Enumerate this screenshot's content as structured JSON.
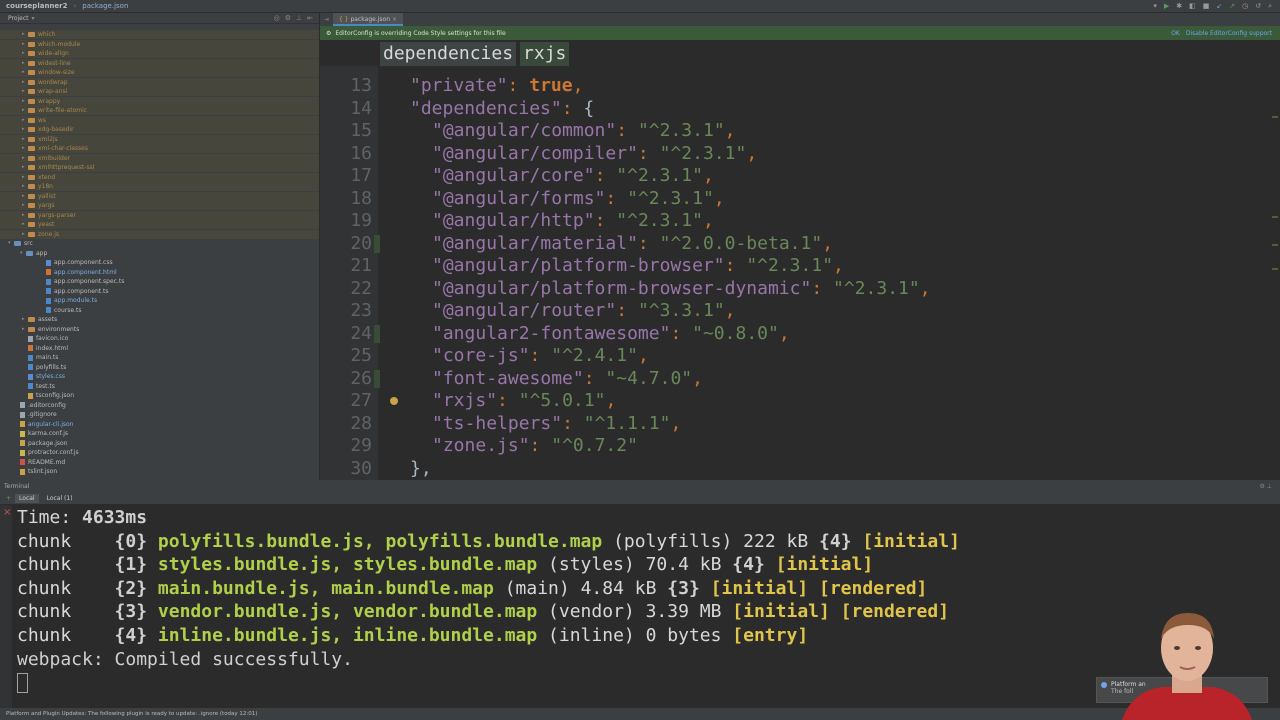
{
  "navbar": {
    "project": "courseplanner2",
    "file": "package.json"
  },
  "project_panel": {
    "title": "Project",
    "items": [
      {
        "label": "which",
        "kind": "folder",
        "style": "dim"
      },
      {
        "label": "which-module",
        "kind": "folder",
        "style": "dim"
      },
      {
        "label": "wide-align",
        "kind": "folder",
        "style": "dim"
      },
      {
        "label": "widest-line",
        "kind": "folder",
        "style": "dim"
      },
      {
        "label": "window-size",
        "kind": "folder",
        "style": "dim"
      },
      {
        "label": "wordwrap",
        "kind": "folder",
        "style": "dim"
      },
      {
        "label": "wrap-ansi",
        "kind": "folder",
        "style": "dim"
      },
      {
        "label": "wrappy",
        "kind": "folder",
        "style": "dim"
      },
      {
        "label": "write-file-atomic",
        "kind": "folder",
        "style": "dim"
      },
      {
        "label": "ws",
        "kind": "folder",
        "style": "dim"
      },
      {
        "label": "xdg-basedir",
        "kind": "folder",
        "style": "dim"
      },
      {
        "label": "xml2js",
        "kind": "folder",
        "style": "dim"
      },
      {
        "label": "xml-char-classes",
        "kind": "folder",
        "style": "dim"
      },
      {
        "label": "xmlbuilder",
        "kind": "folder",
        "style": "dim"
      },
      {
        "label": "xmlhttprequest-ssl",
        "kind": "folder",
        "style": "dim"
      },
      {
        "label": "xtend",
        "kind": "folder",
        "style": "dim"
      },
      {
        "label": "y18n",
        "kind": "folder",
        "style": "dim"
      },
      {
        "label": "yallist",
        "kind": "folder",
        "style": "dim"
      },
      {
        "label": "yargs",
        "kind": "folder",
        "style": "dim"
      },
      {
        "label": "yargs-parser",
        "kind": "folder",
        "style": "dim"
      },
      {
        "label": "yeast",
        "kind": "folder",
        "style": "dim"
      },
      {
        "label": "zone.js",
        "kind": "folder",
        "style": "dim"
      },
      {
        "label": "src",
        "kind": "folder-open",
        "style": "norm"
      },
      {
        "label": "app",
        "kind": "folder-open",
        "style": "norm"
      },
      {
        "label": "app.component.css",
        "kind": "file",
        "style": "norm"
      },
      {
        "label": "app.component.html",
        "kind": "file",
        "style": "blue"
      },
      {
        "label": "app.component.spec.ts",
        "kind": "file",
        "style": "norm"
      },
      {
        "label": "app.component.ts",
        "kind": "file",
        "style": "norm"
      },
      {
        "label": "app.module.ts",
        "kind": "file",
        "style": "blue"
      },
      {
        "label": "course.ts",
        "kind": "file",
        "style": "norm"
      },
      {
        "label": "assets",
        "kind": "folder",
        "style": "norm"
      },
      {
        "label": "environments",
        "kind": "folder",
        "style": "norm"
      },
      {
        "label": "favicon.ico",
        "kind": "file",
        "style": "norm"
      },
      {
        "label": "index.html",
        "kind": "file",
        "style": "norm"
      },
      {
        "label": "main.ts",
        "kind": "file",
        "style": "norm"
      },
      {
        "label": "polyfills.ts",
        "kind": "file",
        "style": "norm"
      },
      {
        "label": "styles.css",
        "kind": "file",
        "style": "blue"
      },
      {
        "label": "test.ts",
        "kind": "file",
        "style": "norm"
      },
      {
        "label": "tsconfig.json",
        "kind": "file",
        "style": "norm"
      },
      {
        "label": ".editorconfig",
        "kind": "file",
        "style": "norm"
      },
      {
        "label": ".gitignore",
        "kind": "file",
        "style": "norm"
      },
      {
        "label": "angular-cli.json",
        "kind": "file",
        "style": "blue"
      },
      {
        "label": "karma.conf.js",
        "kind": "file",
        "style": "norm"
      },
      {
        "label": "package.json",
        "kind": "file",
        "style": "norm"
      },
      {
        "label": "protractor.conf.js",
        "kind": "file",
        "style": "norm"
      },
      {
        "label": "README.md",
        "kind": "file",
        "style": "norm"
      },
      {
        "label": "tslint.json",
        "kind": "file",
        "style": "norm"
      }
    ]
  },
  "editor": {
    "tab": "package.json",
    "banner": "EditorConfig is overriding Code Style settings for this file",
    "banner_ok": "OK",
    "banner_disable": "Disable EditorConfig support",
    "breadcrumb": [
      "dependencies",
      "rxjs"
    ],
    "lines": [
      {
        "n": "13",
        "key": "private",
        "val": "true",
        "bool": true,
        "tail": ","
      },
      {
        "n": "14",
        "key": "dependencies",
        "val": "{",
        "obj": true,
        "tail": ""
      },
      {
        "n": "15",
        "key": "@angular/common",
        "val": "^2.3.1",
        "tail": ","
      },
      {
        "n": "16",
        "key": "@angular/compiler",
        "val": "^2.3.1",
        "tail": ","
      },
      {
        "n": "17",
        "key": "@angular/core",
        "val": "^2.3.1",
        "tail": ","
      },
      {
        "n": "18",
        "key": "@angular/forms",
        "val": "^2.3.1",
        "tail": ","
      },
      {
        "n": "19",
        "key": "@angular/http",
        "val": "^2.3.1",
        "tail": ","
      },
      {
        "n": "20",
        "key": "@angular/material",
        "val": "^2.0.0-beta.1",
        "tail": ","
      },
      {
        "n": "21",
        "key": "@angular/platform-browser",
        "val": "^2.3.1",
        "tail": ","
      },
      {
        "n": "22",
        "key": "@angular/platform-browser-dynamic",
        "val": "^2.3.1",
        "tail": ","
      },
      {
        "n": "23",
        "key": "@angular/router",
        "val": "^3.3.1",
        "tail": ","
      },
      {
        "n": "24",
        "key": "angular2-fontawesome",
        "val": "~0.8.0",
        "tail": ","
      },
      {
        "n": "25",
        "key": "core-js",
        "val": "^2.4.1",
        "tail": ","
      },
      {
        "n": "26",
        "key": "font-awesome",
        "val": "~4.7.0",
        "tail": ","
      },
      {
        "n": "27",
        "key": "rxjs",
        "val": "^5.0.1",
        "tail": ","
      },
      {
        "n": "28",
        "key": "ts-helpers",
        "val": "^1.1.1",
        "tail": ","
      },
      {
        "n": "29",
        "key": "zone.js",
        "val": "^0.7.2",
        "tail": ""
      },
      {
        "n": "30",
        "close": "},"
      }
    ]
  },
  "terminal": {
    "panel_label": "Terminal",
    "tabs": [
      "Local",
      "Local (1)"
    ],
    "time_label": "Time:",
    "time_value": "4633ms",
    "chunks": [
      {
        "word": "chunk",
        "id": "{0}",
        "files": "polyfills.bundle.js, polyfills.bundle.map",
        "name": "(polyfills)",
        "size": "222 kB",
        "parent": "{4}",
        "flags": "[initial]"
      },
      {
        "word": "chunk",
        "id": "{1}",
        "files": "styles.bundle.js, styles.bundle.map",
        "name": "(styles)",
        "size": "70.4 kB",
        "parent": "{4}",
        "flags": "[initial]"
      },
      {
        "word": "chunk",
        "id": "{2}",
        "files": "main.bundle.js, main.bundle.map",
        "name": "(main)",
        "size": "4.84 kB",
        "parent": "{3}",
        "flags": "[initial] [rendered]"
      },
      {
        "word": "chunk",
        "id": "{3}",
        "files": "vendor.bundle.js, vendor.bundle.map",
        "name": "(vendor)",
        "size": "3.39 MB",
        "parent": "",
        "flags": "[initial] [rendered]"
      },
      {
        "word": "chunk",
        "id": "{4}",
        "files": "inline.bundle.js, inline.bundle.map",
        "name": "(inline)",
        "size": "0 bytes",
        "parent": "",
        "flags": "[entry]"
      }
    ],
    "done": "webpack: Compiled successfully."
  },
  "statusbar": {
    "text": "Platform and Plugin Updates: The following plugin is ready to update: .ignore (today 12:01)"
  },
  "notification": {
    "title": "Platform an",
    "body": "The foll"
  }
}
